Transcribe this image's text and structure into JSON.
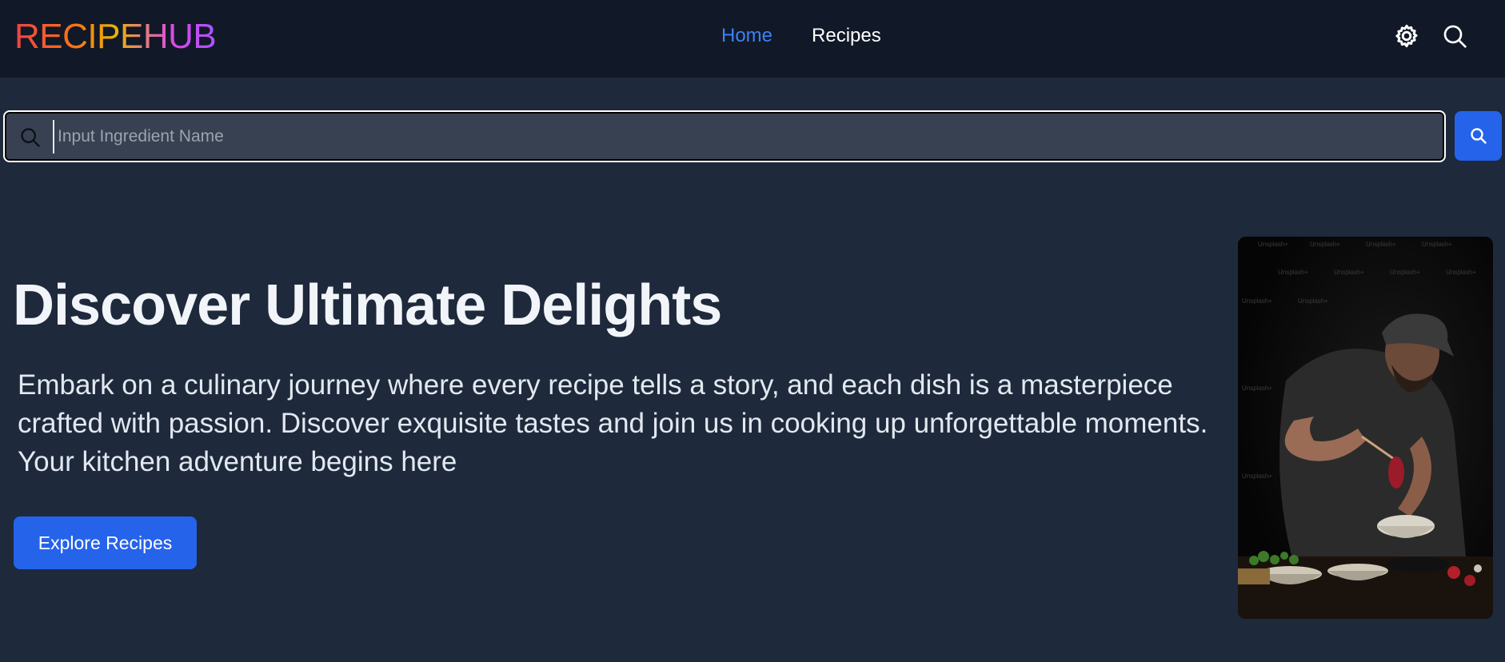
{
  "brand": {
    "logo_text": "RECIPEHUB"
  },
  "nav": {
    "links": [
      {
        "label": "Home",
        "active": true
      },
      {
        "label": "Recipes",
        "active": false
      }
    ],
    "icons": [
      "gear-icon",
      "search-icon"
    ]
  },
  "search": {
    "placeholder": "Input Ingredient Name",
    "value": "",
    "button_icon": "search-icon"
  },
  "hero": {
    "title": "Discover Ultimate Delights",
    "description": "Embark on a culinary journey where every recipe tells a story, and each dish is a masterpiece crafted with passion. Discover exquisite tastes and join us in cooking up unforgettable moments. Your kitchen adventure begins here",
    "cta_label": "Explore Recipes",
    "image_subject": "chef plating raw meat with chopsticks over bowls on a dark kitchen counter",
    "image_watermark": "Unsplash+"
  },
  "colors": {
    "nav_bg": "#111827",
    "page_bg": "#1e293b",
    "accent": "#2563eb",
    "active_link": "#3b82f6",
    "input_bg": "#374151"
  }
}
